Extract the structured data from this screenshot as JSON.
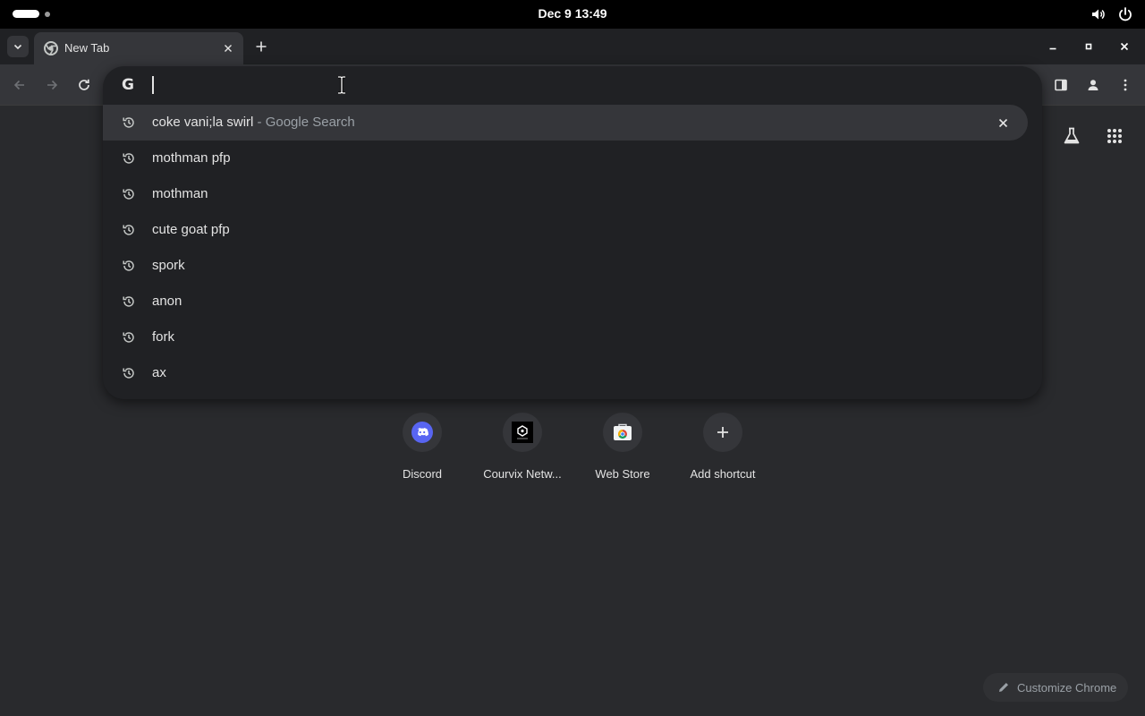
{
  "system_bar": {
    "clock": "Dec 9  13:49"
  },
  "tabs": [
    {
      "title": "New Tab"
    }
  ],
  "omnibox": {
    "input_value": "",
    "suggestions": [
      {
        "text": "coke vani;la swirl",
        "description": "- Google Search",
        "selected": true
      },
      {
        "text": "mothman pfp"
      },
      {
        "text": "mothman"
      },
      {
        "text": "cute goat pfp"
      },
      {
        "text": "spork"
      },
      {
        "text": "anon"
      },
      {
        "text": "fork"
      },
      {
        "text": "ax"
      }
    ]
  },
  "shortcuts": [
    {
      "label": "Discord",
      "icon": "discord-icon",
      "color": "#5865f2"
    },
    {
      "label": "Courvix Netw...",
      "icon": "courvix-icon",
      "color": "#000000"
    },
    {
      "label": "Web Store",
      "icon": "web-store-icon",
      "color": "#ffffff"
    },
    {
      "label": "Add shortcut",
      "icon": "plus-icon",
      "color": "#e3e3e3"
    }
  ],
  "customize": {
    "label": "Customize Chrome"
  },
  "colors": {
    "page_bg": "#292a2d",
    "dropdown_bg": "#202124",
    "selected_row": "#35363a",
    "muted_text": "#9aa0a6"
  }
}
